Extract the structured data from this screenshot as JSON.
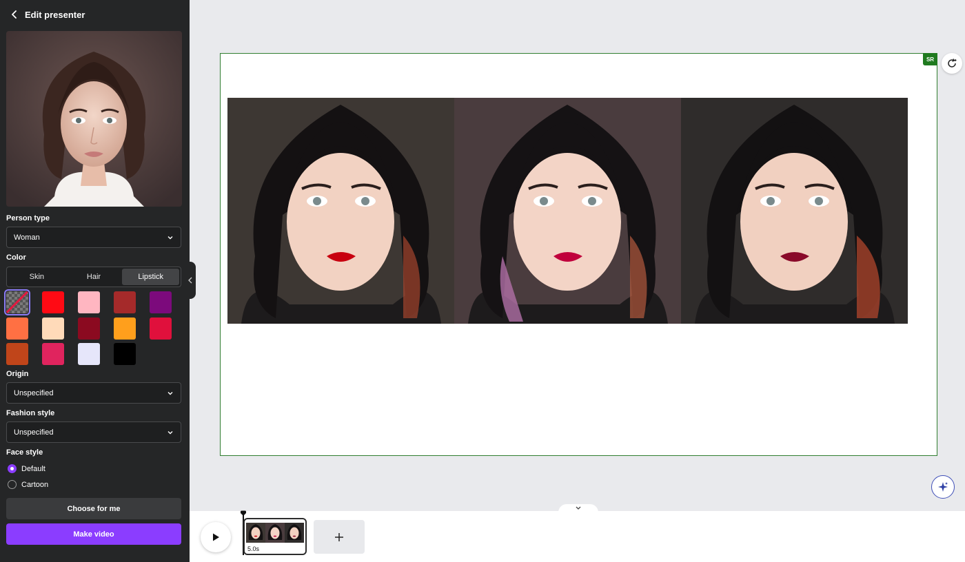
{
  "panel": {
    "title": "Edit presenter",
    "person_type": {
      "label": "Person type",
      "value": "Woman"
    },
    "color": {
      "label": "Color",
      "tabs": [
        "Skin",
        "Hair",
        "Lipstick"
      ],
      "active_tab": "Lipstick",
      "swatches": [
        "none",
        "#ff0a14",
        "#ffb6c1",
        "#a52a2a",
        "#7c0a7c",
        "#ff7043",
        "#ffdab9",
        "#8b0a20",
        "#ff9f1c",
        "#e0103c",
        "#c0451a",
        "#e0245e",
        "#e6e6fa",
        "#000000"
      ],
      "selected_swatch": "none"
    },
    "origin": {
      "label": "Origin",
      "value": "Unspecified"
    },
    "fashion_style": {
      "label": "Fashion style",
      "value": "Unspecified"
    },
    "face_style": {
      "label": "Face style",
      "options": [
        "Default",
        "Cartoon"
      ],
      "selected": "Default"
    },
    "choose_button": "Choose for me",
    "make_button": "Make video"
  },
  "canvas": {
    "badge": "SR",
    "lip_colors": [
      "#c8000f",
      "#c0003c",
      "#8a0a2a"
    ]
  },
  "timeline": {
    "clip_duration": "5.0s"
  },
  "colors": {
    "accent": "#8b3dff",
    "panel_bg": "#252627",
    "canvas_bg": "#e9eaed",
    "selection_border": "#2f7d2f"
  }
}
